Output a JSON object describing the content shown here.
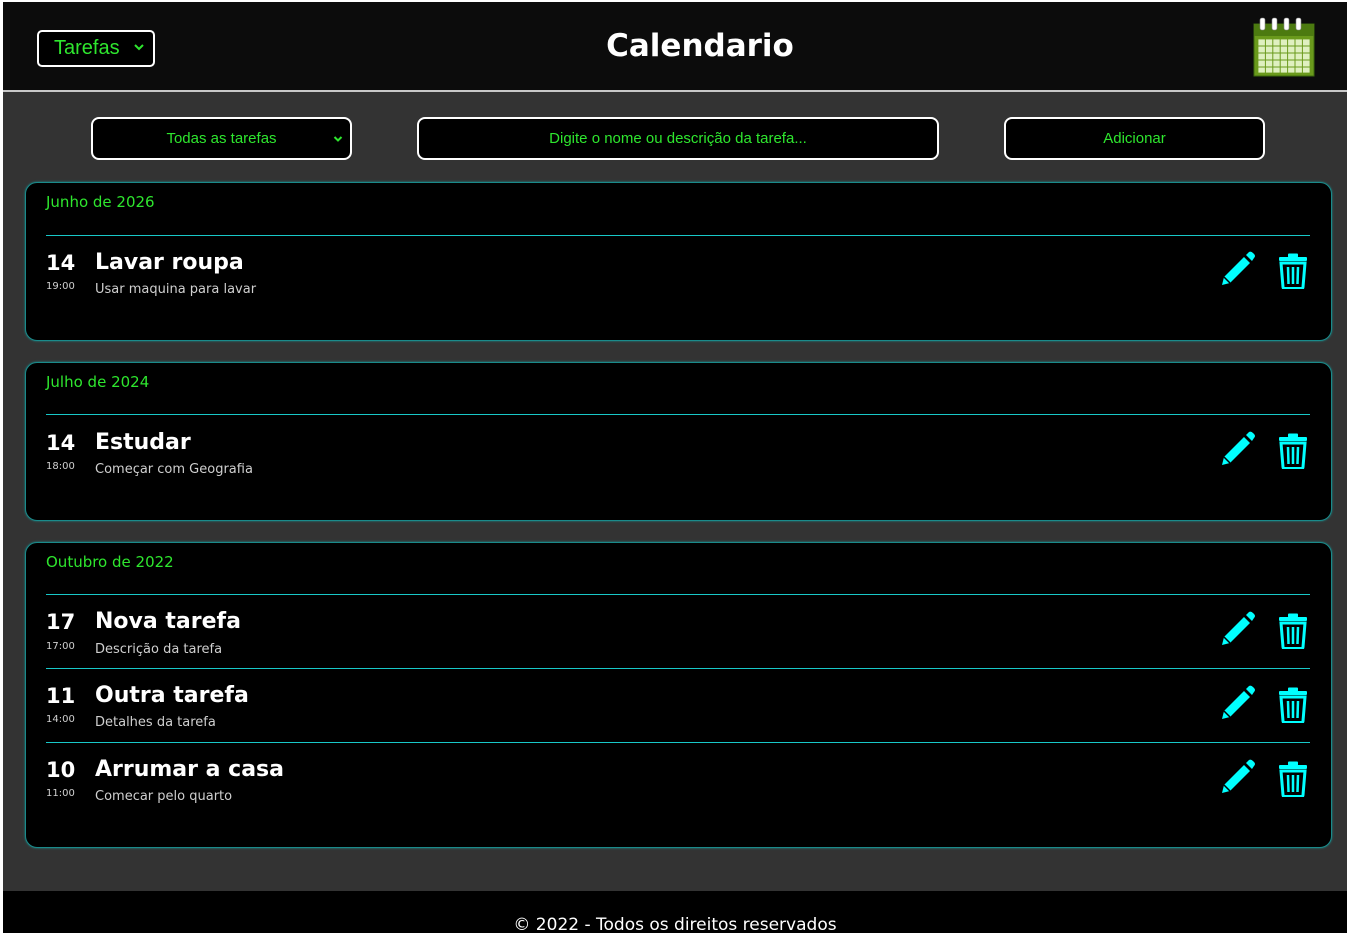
{
  "header": {
    "view_select": "Tarefas",
    "title": "Calendario",
    "calendar_icon": "calendar-icon"
  },
  "toolbar": {
    "filter_select": "Todas as tarefas",
    "search_placeholder": "Digite o nome ou descrição da tarefa...",
    "add_label": "Adicionar"
  },
  "months": [
    {
      "label": "Junho de 2026",
      "tasks": [
        {
          "day": "14",
          "time": "19:00",
          "title": "Lavar roupa",
          "description": "Usar maquina para lavar"
        }
      ]
    },
    {
      "label": "Julho de 2024",
      "tasks": [
        {
          "day": "14",
          "time": "18:00",
          "title": "Estudar",
          "description": "Começar com Geografia"
        }
      ]
    },
    {
      "label": "Outubro de 2022",
      "tasks": [
        {
          "day": "17",
          "time": "17:00",
          "title": "Nova tarefa",
          "description": "Descrição da tarefa"
        },
        {
          "day": "11",
          "time": "14:00",
          "title": "Outra tarefa",
          "description": "Detalhes da tarefa"
        },
        {
          "day": "10",
          "time": "11:00",
          "title": "Arrumar a casa",
          "description": "Comecar pelo quarto"
        }
      ]
    }
  ],
  "icons": {
    "edit": "pencil-icon",
    "delete": "trash-icon"
  },
  "colors": {
    "accent_green": "#2ee62e",
    "accent_cyan": "#00ffff",
    "card_border": "#1a8a8a",
    "background": "#333333"
  },
  "footer": {
    "text": "© 2022 - Todos os direitos reservados"
  }
}
